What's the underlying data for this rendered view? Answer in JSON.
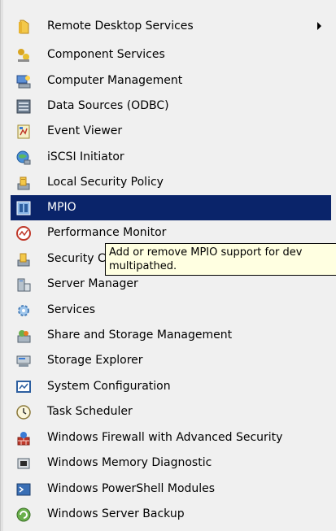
{
  "menu": {
    "items": [
      {
        "label": "Remote Desktop Services",
        "icon": "folder-icon",
        "has_submenu": true
      },
      {
        "label": "Component Services",
        "icon": "component-services-icon"
      },
      {
        "label": "Computer Management",
        "icon": "computer-management-icon"
      },
      {
        "label": "Data Sources (ODBC)",
        "icon": "data-sources-icon"
      },
      {
        "label": "Event Viewer",
        "icon": "event-viewer-icon"
      },
      {
        "label": "iSCSI Initiator",
        "icon": "iscsi-globe-icon"
      },
      {
        "label": "Local Security Policy",
        "icon": "security-policy-icon"
      },
      {
        "label": "MPIO",
        "icon": "mpio-icon",
        "selected": true
      },
      {
        "label": "Performance Monitor",
        "icon": "performance-monitor-icon"
      },
      {
        "label": "Security C",
        "icon": "security-configuration-icon"
      },
      {
        "label": "Server Manager",
        "icon": "server-manager-icon"
      },
      {
        "label": "Services",
        "icon": "services-gear-icon"
      },
      {
        "label": "Share and Storage Management",
        "icon": "share-storage-icon"
      },
      {
        "label": "Storage Explorer",
        "icon": "storage-explorer-icon"
      },
      {
        "label": "System Configuration",
        "icon": "system-configuration-icon"
      },
      {
        "label": "Task Scheduler",
        "icon": "clock-icon"
      },
      {
        "label": "Windows Firewall with Advanced Security",
        "icon": "firewall-icon"
      },
      {
        "label": "Windows Memory Diagnostic",
        "icon": "memory-diagnostic-icon"
      },
      {
        "label": "Windows PowerShell Modules",
        "icon": "powershell-icon"
      },
      {
        "label": "Windows Server Backup",
        "icon": "server-backup-icon"
      }
    ]
  },
  "tooltip": {
    "text": "Add or remove MPIO support for dev\nmultipathed."
  },
  "colors": {
    "selection": "#0a246a",
    "tooltip_bg": "#ffffe1",
    "menu_bg": "#f0f0f0"
  }
}
